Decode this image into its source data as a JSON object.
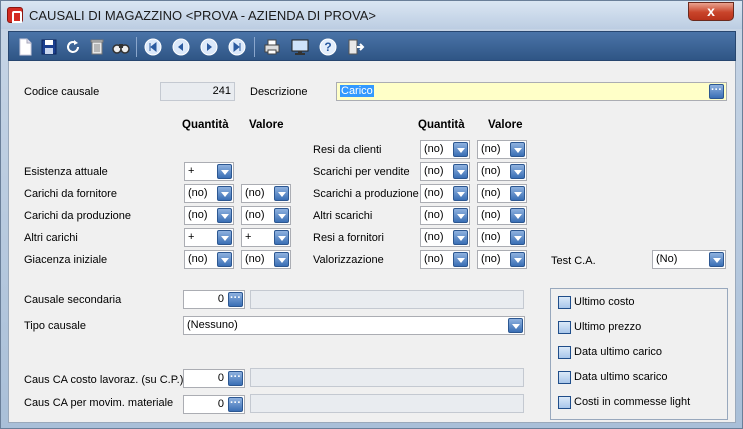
{
  "window": {
    "title": "CAUSALI DI MAGAZZINO <PROVA - AZIENDA DI PROVA>",
    "close": "x"
  },
  "toolbar": {
    "icons": [
      "new-icon",
      "save-icon",
      "refresh-icon",
      "delete-icon",
      "find-icon",
      "first-icon",
      "prev-icon",
      "next-icon",
      "last-icon",
      "print-icon",
      "preview-icon",
      "help-icon",
      "exit-icon"
    ]
  },
  "header": {
    "codice_label": "Codice causale",
    "codice_value": "241",
    "descrizione_label": "Descrizione",
    "descrizione_value": "Carico"
  },
  "left": {
    "col_quantita": "Quantità",
    "col_valore": "Valore",
    "rows": [
      {
        "label": "Esistenza attuale",
        "quantita": "+",
        "valore": null
      },
      {
        "label": "Carichi da fornitore",
        "quantita": "(no)",
        "valore": "(no)"
      },
      {
        "label": "Carichi da produzione",
        "quantita": "(no)",
        "valore": "(no)"
      },
      {
        "label": "Altri carichi",
        "quantita": "+",
        "valore": "+"
      },
      {
        "label": "Giacenza iniziale",
        "quantita": "(no)",
        "valore": "(no)"
      }
    ]
  },
  "right": {
    "col_quantita": "Quantità",
    "col_valore": "Valore",
    "rows": [
      {
        "label": "Resi da clienti",
        "quantita": "(no)",
        "valore": "(no)"
      },
      {
        "label": "Scarichi per vendite",
        "quantita": "(no)",
        "valore": "(no)"
      },
      {
        "label": "Scarichi a produzione",
        "quantita": "(no)",
        "valore": "(no)"
      },
      {
        "label": "Altri scarichi",
        "quantita": "(no)",
        "valore": "(no)"
      },
      {
        "label": "Resi a fornitori",
        "quantita": "(no)",
        "valore": "(no)"
      },
      {
        "label": "Valorizzazione",
        "quantita": "(no)",
        "valore": "(no)"
      }
    ]
  },
  "test_ca": {
    "label": "Test C.A.",
    "value": "(No)"
  },
  "bottom": {
    "causale_secondaria_label": "Causale secondaria",
    "causale_secondaria_value": "0",
    "tipo_causale_label": "Tipo causale",
    "tipo_causale_value": "(Nessuno)",
    "caus_ca_costo_label": "Caus CA costo lavoraz. (su C.P.)",
    "caus_ca_costo_value": "0",
    "caus_ca_movim_label": "Caus CA per movim. materiale",
    "caus_ca_movim_value": "0"
  },
  "checkboxes": [
    "Ultimo costo",
    "Ultimo prezzo",
    "Data ultimo carico",
    "Data ultimo scarico",
    "Costi in commesse light"
  ]
}
